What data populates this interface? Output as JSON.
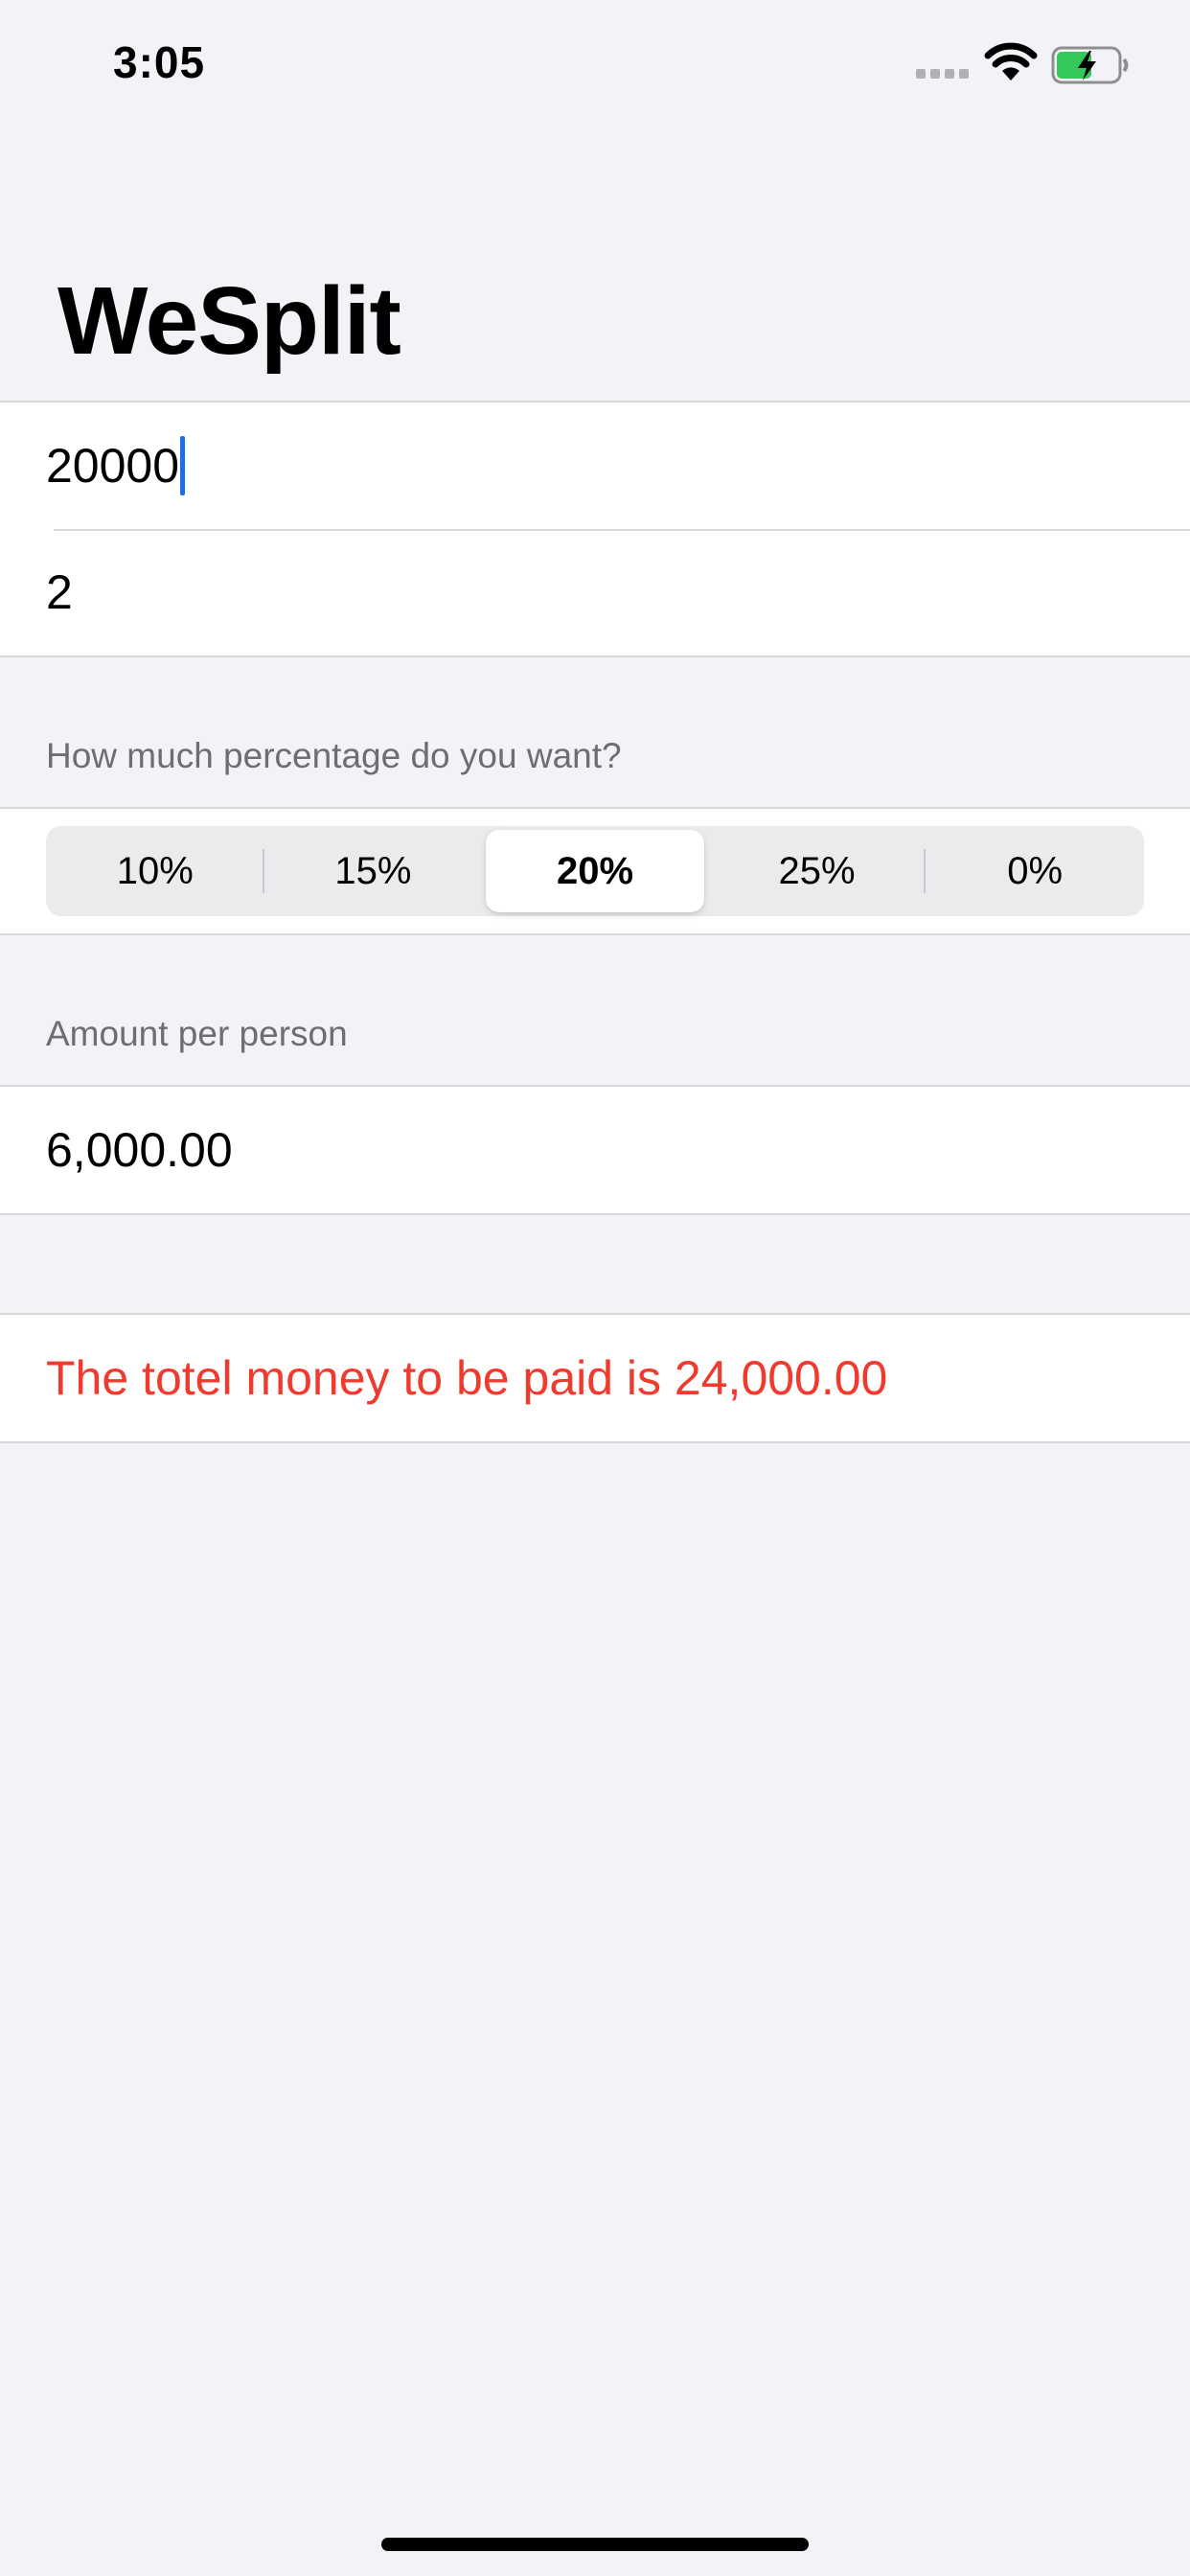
{
  "status_bar": {
    "time": "3:05"
  },
  "title": "WeSplit",
  "inputs": {
    "check_amount": "20000",
    "number_of_people": "2"
  },
  "tip_section": {
    "header": "How much percentage do you want?",
    "options": [
      "10%",
      "15%",
      "20%",
      "25%",
      "0%"
    ],
    "selected": "20%"
  },
  "amount_section": {
    "header": "Amount per person",
    "value": "6,000.00"
  },
  "total": {
    "text": "The totel money to be paid is 24,000.00",
    "color": "#f03a2e"
  },
  "colors": {
    "accent": "#1a6ee8",
    "background": "#f2f2f7",
    "battery": "#34c759"
  },
  "icons": [
    "wifi-icon",
    "battery-charging-icon",
    "cellular-signal-icon"
  ]
}
